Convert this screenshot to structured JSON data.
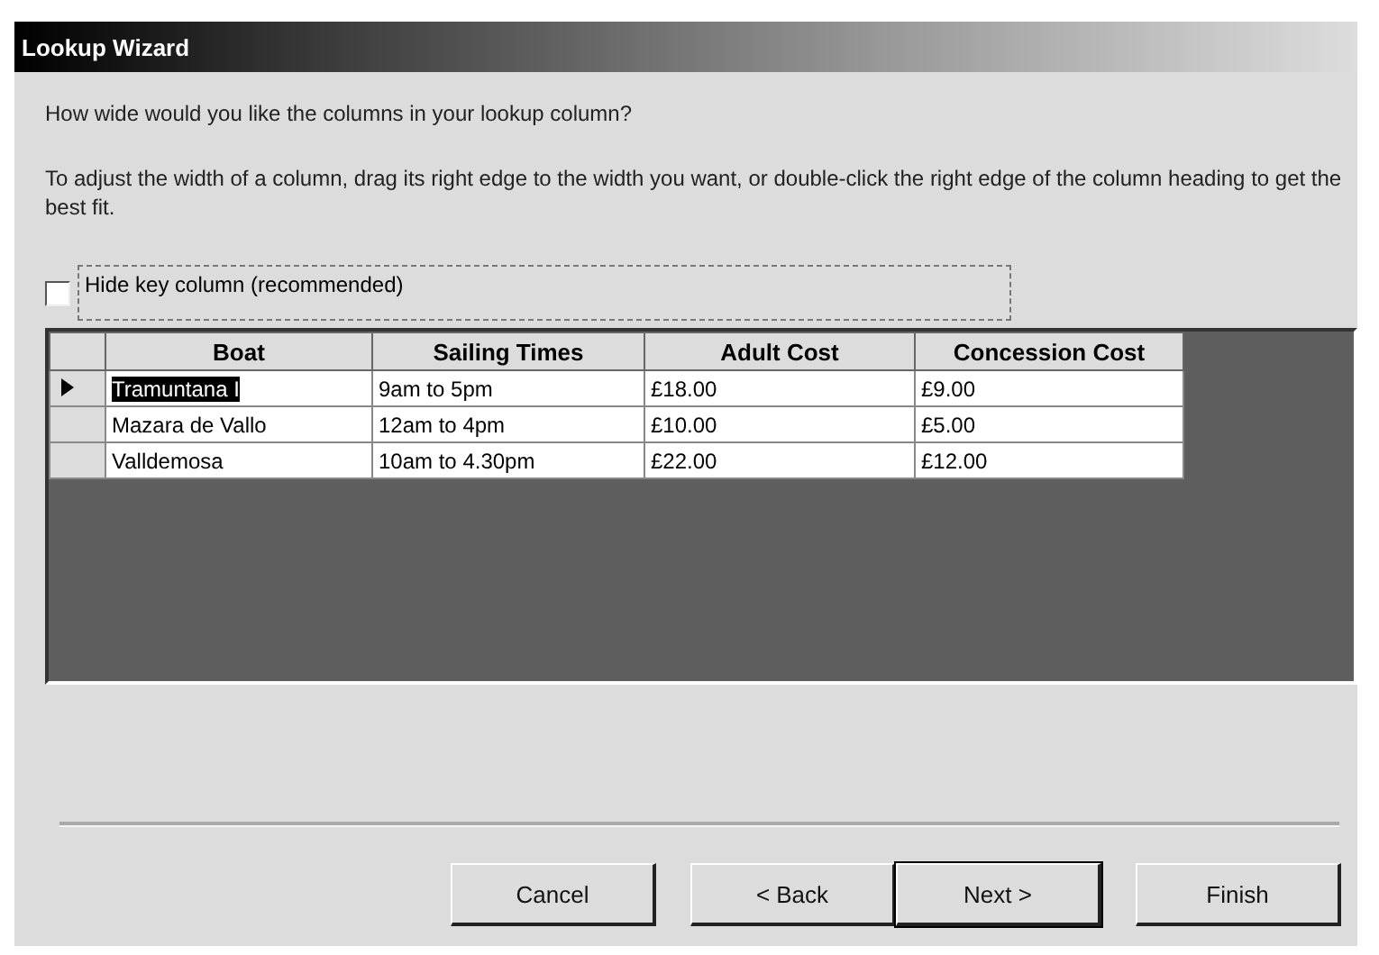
{
  "window": {
    "title": "Lookup Wizard"
  },
  "question": "How wide would you like the columns in your lookup column?",
  "instructions": "To adjust the width of a column, drag its right edge to the width you want, or double-click the right edge of the column heading to get the best fit.",
  "hide_key": {
    "label": "Hide key column (recommended)",
    "checked": false
  },
  "table": {
    "columns": [
      "Boat",
      "Sailing Times",
      "Adult Cost",
      "Concession Cost"
    ],
    "rows": [
      {
        "selected": true,
        "cells": [
          "Tramuntana I",
          "9am to 5pm",
          "£18.00",
          "£9.00"
        ]
      },
      {
        "selected": false,
        "cells": [
          "Mazara de Vallo",
          "12am to 4pm",
          "£10.00",
          "£5.00"
        ]
      },
      {
        "selected": false,
        "cells": [
          "Valldemosa",
          "10am to 4.30pm",
          "£22.00",
          "£12.00"
        ]
      }
    ]
  },
  "buttons": [
    {
      "label": "Cancel",
      "default": false
    },
    {
      "label": "< Back",
      "default": false
    },
    {
      "label": "Next >",
      "default": true
    },
    {
      "label": "Finish",
      "default": false
    }
  ]
}
